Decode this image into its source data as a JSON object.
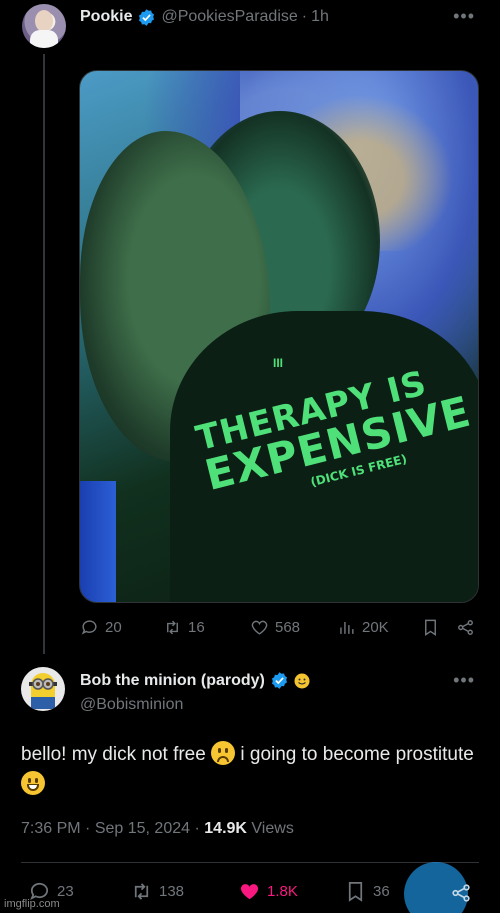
{
  "post1": {
    "display_name": "Pookie",
    "handle": "@PookiesParadise",
    "separator": "·",
    "time": "1h",
    "media": {
      "shirt_line1": "THERAPY IS",
      "shirt_line2": "EXPENSIVE",
      "shirt_line3": "(DICK IS FREE)",
      "necklace": "III"
    },
    "stats": {
      "replies": "20",
      "reposts": "16",
      "likes": "568",
      "views": "20K"
    }
  },
  "post2": {
    "display_name": "Bob the minion (parody)",
    "handle": "@Bobisminion",
    "text_part1": "bello! my dick not free",
    "text_part2": "i going to become prostitute",
    "time": "7:36 PM",
    "date": "Sep 15, 2024",
    "views_count": "14.9K",
    "views_label": "Views",
    "separator": "·",
    "stats": {
      "replies": "23",
      "reposts": "138",
      "likes": "1.8K",
      "bookmarks": "36"
    }
  },
  "watermark": "imgflip.com",
  "colors": {
    "background": "#000000",
    "text": "#e7e9ea",
    "muted": "#71767b",
    "verified": "#1d9bf0",
    "like_active": "#f91880"
  }
}
